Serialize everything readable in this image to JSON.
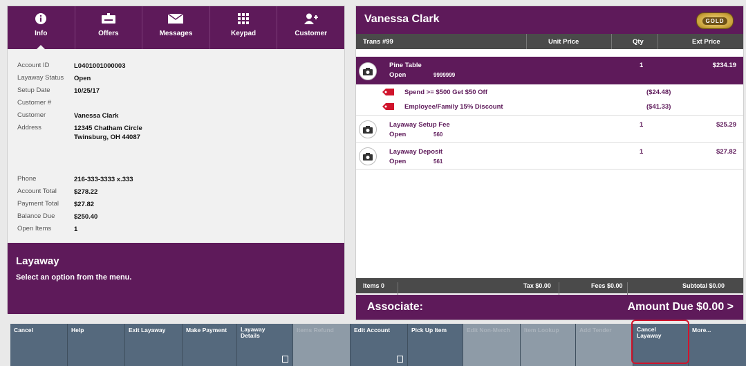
{
  "tabs": [
    {
      "label": "Info",
      "icon": "info-icon"
    },
    {
      "label": "Offers",
      "icon": "coupon-icon"
    },
    {
      "label": "Messages",
      "icon": "envelope-icon"
    },
    {
      "label": "Keypad",
      "icon": "keypad-icon"
    },
    {
      "label": "Customer",
      "icon": "add-customer-icon"
    }
  ],
  "account": {
    "rows": [
      {
        "key": "Account ID",
        "value": "L0401001000003"
      },
      {
        "key": "Layaway Status",
        "value": "Open"
      },
      {
        "key": "Setup Date",
        "value": "10/25/17"
      },
      {
        "key": "Customer #",
        "value": ""
      },
      {
        "key": "Customer",
        "value": "Vanessa Clark"
      },
      {
        "key": "Address",
        "value": "12345 Chatham Circle\nTwinsburg, OH 44087"
      },
      {
        "key": "Phone",
        "value": "216-333-3333 x.333"
      },
      {
        "key": "Account Total",
        "value": "$278.22"
      },
      {
        "key": "Payment Total",
        "value": "$27.82"
      },
      {
        "key": "Balance Due",
        "value": "$250.40"
      },
      {
        "key": "Open Items",
        "value": "1"
      }
    ]
  },
  "message": {
    "title": "Layaway",
    "subtitle": "Select an option from the menu."
  },
  "customer": {
    "name": "Vanessa Clark",
    "tier": "GOLD"
  },
  "columns": {
    "trans": "Trans #99",
    "unit_price": "Unit Price",
    "qty": "Qty",
    "ext_price": "Ext Price"
  },
  "items": [
    {
      "name": "Pine Table",
      "status": "Open",
      "sku": "9999999",
      "qty": "1",
      "ext": "$234.19"
    },
    {
      "name": "Layaway Setup Fee",
      "status": "Open",
      "sku": "560",
      "qty": "1",
      "ext": "$25.29"
    },
    {
      "name": "Layaway Deposit",
      "status": "Open",
      "sku": "561",
      "qty": "1",
      "ext": "$27.82"
    }
  ],
  "discounts": [
    {
      "name": "Spend >= $500 Get $50 Off",
      "amount": "($24.48)"
    },
    {
      "name": "Employee/Family 15% Discount",
      "amount": "($41.33)"
    }
  ],
  "totals": {
    "items": "Items 0",
    "tax": "Tax $0.00",
    "fees": "Fees $0.00",
    "subtotal": "Subtotal $0.00"
  },
  "footer": {
    "associate": "Associate:",
    "amount_due": "Amount Due  $0.00  >"
  },
  "buttons": [
    {
      "label": "Cancel",
      "enabled": true
    },
    {
      "label": "Help",
      "enabled": true
    },
    {
      "label": "Exit Layaway",
      "enabled": true
    },
    {
      "label": "Make Payment",
      "enabled": true
    },
    {
      "label": "Layaway\nDetails",
      "enabled": true
    },
    {
      "label": "Items Refund",
      "enabled": false
    },
    {
      "label": "Edit Account",
      "enabled": true
    },
    {
      "label": "Pick Up Item",
      "enabled": true
    },
    {
      "label": "Edit Non-Merch",
      "enabled": false
    },
    {
      "label": "Item Lookup",
      "enabled": false
    },
    {
      "label": "Add Tender",
      "enabled": false
    },
    {
      "label": "Cancel\nLayaway",
      "enabled": true
    },
    {
      "label": "More...",
      "enabled": true
    }
  ],
  "colors": {
    "brand_purple": "#5e1a5a",
    "button_slate": "#55697d",
    "highlight_red": "#d0142c"
  }
}
